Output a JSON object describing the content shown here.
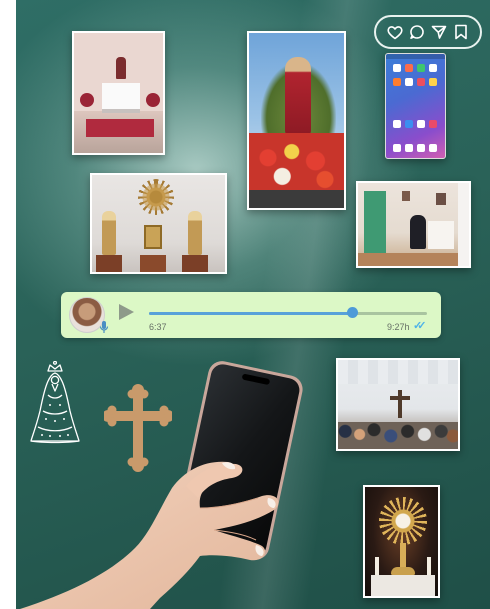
{
  "voice_message": {
    "duration": "6:37",
    "timestamp": "9:27h",
    "progress": 0.73
  },
  "social_actions": [
    "heart-icon",
    "comment-icon",
    "share-icon",
    "bookmark-icon"
  ],
  "colors": {
    "background": "#2a6258",
    "voice_bubble": "#dcf8c6",
    "read_ticks": "#4fb3e8",
    "cross_wood": "#c99a6b"
  }
}
